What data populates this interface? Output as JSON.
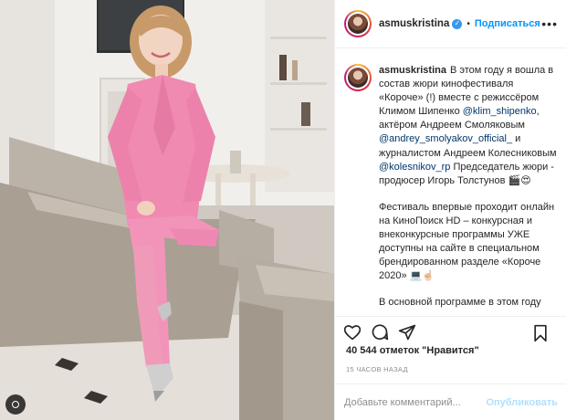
{
  "post": {
    "username": "asmuskristina",
    "follow_label": "Подписаться",
    "more_icon": "more-icon",
    "verified_icon": "verified-badge-icon",
    "caption": {
      "p1_pre": "В этом году я вошла в состав жюри кинофестиваля «Короче» (!) вместе с режиссёром Климом Шипенко ",
      "mention1": "@klim_shipenko",
      "p1_mid1": ", актёром Андреем Смоляковым ",
      "mention2": "@andrey_smolyakov_official_",
      "p1_mid2": " и журналистом Андреем Колесниковым ",
      "mention3": "@kolesnikov_rp",
      "p1_post": " Председатель жюри - продюсер Игорь Толстунов 🎬😍",
      "p2": "Фестиваль впервые проходит онлайн на КиноПоиск HD – конкурсная и внеконкурсные программы УЖЕ доступны на сайте в специальном брендированном разделе «Короче 2020» 💻☝🏻",
      "p3": "В основной программе в этом году"
    },
    "likes": "40 544 отметок \"Нравится\"",
    "time": "15 ЧАСОВ НАЗАД",
    "comment_placeholder": "Добавьте комментарий...",
    "post_button": "Опубликовать"
  },
  "icons": {
    "like": "heart-icon",
    "comment": "comment-icon",
    "share": "share-icon",
    "save": "bookmark-icon",
    "gallery": "gallery-indicator-icon"
  },
  "colors": {
    "accent": "#0095f6",
    "post_disabled": "#b2dffc",
    "verified": "#3897f0",
    "suit": "#f08ab1"
  }
}
